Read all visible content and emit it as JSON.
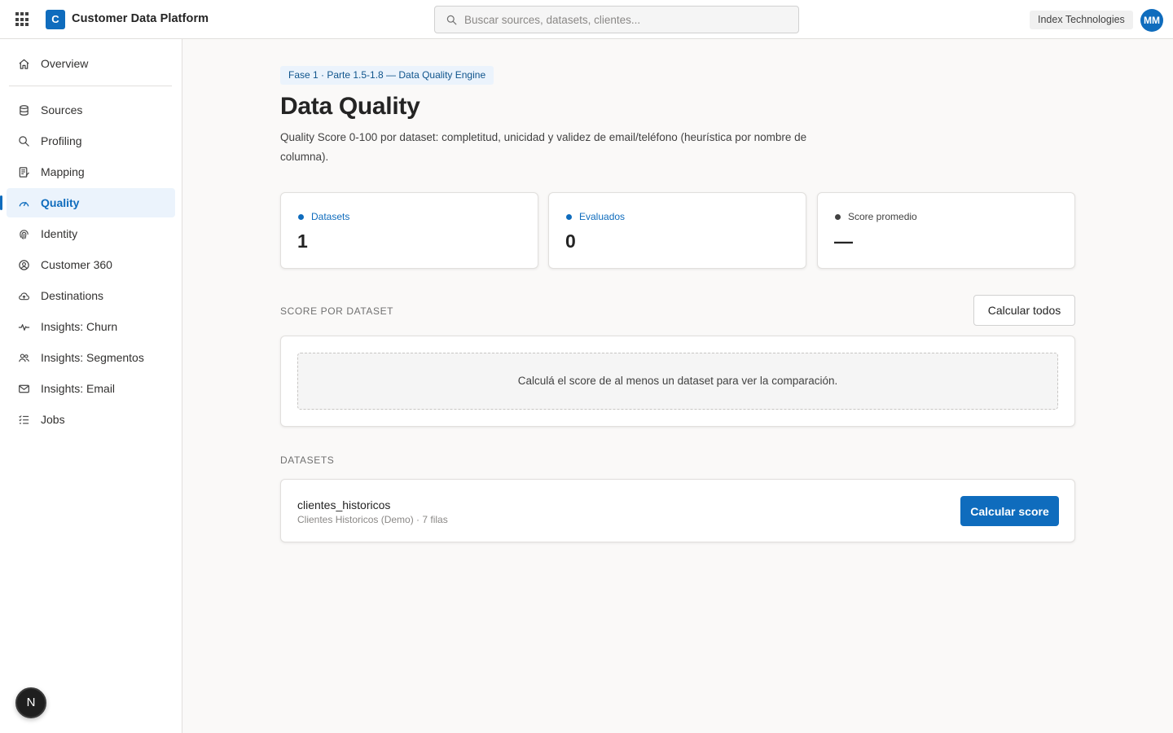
{
  "header": {
    "brand_initial": "C",
    "brand_name": "Customer Data Platform",
    "search_placeholder": "Buscar sources, datasets, clientes...",
    "tenant": "Index Technologies",
    "user_initials": "MM"
  },
  "sidebar": {
    "items": [
      {
        "label": "Overview",
        "icon": "home-icon"
      },
      {
        "label": "Sources",
        "icon": "database-icon"
      },
      {
        "label": "Profiling",
        "icon": "search-icon"
      },
      {
        "label": "Mapping",
        "icon": "mapping-icon"
      },
      {
        "label": "Quality",
        "icon": "gauge-icon",
        "active": true
      },
      {
        "label": "Identity",
        "icon": "fingerprint-icon"
      },
      {
        "label": "Customer 360",
        "icon": "user-circle-icon"
      },
      {
        "label": "Destinations",
        "icon": "cloud-upload-icon"
      },
      {
        "label": "Insights: Churn",
        "icon": "pulse-icon"
      },
      {
        "label": "Insights: Segmentos",
        "icon": "people-icon"
      },
      {
        "label": "Insights: Email",
        "icon": "mail-icon"
      },
      {
        "label": "Jobs",
        "icon": "task-list-icon"
      }
    ],
    "badge": "N"
  },
  "page": {
    "breadcrumb_pill": "Fase 1 · Parte 1.5-1.8 — Data Quality Engine",
    "title": "Data Quality",
    "subtitle": "Quality Score 0-100 por dataset: completitud, unicidad y validez de email/teléfono (heurística por nombre de columna)."
  },
  "stats": [
    {
      "label": "Datasets",
      "value": "1",
      "color": "#0f6cbd"
    },
    {
      "label": "Evaluados",
      "value": "0",
      "color": "#0f6cbd"
    },
    {
      "label": "Score promedio",
      "value": "—",
      "color": "#424242"
    }
  ],
  "score_section": {
    "label": "SCORE POR DATASET",
    "calc_all_label": "Calcular todos",
    "empty_message": "Calculá el score de al menos un dataset para ver la comparación."
  },
  "datasets_section": {
    "label": "DATASETS",
    "rows": [
      {
        "name": "clientes_historicos",
        "meta": "Clientes Historicos (Demo) · 7 filas",
        "action": "Calcular score"
      }
    ]
  },
  "colors": {
    "accent": "#0f6cbd",
    "active_bg": "#ebf3fc"
  }
}
